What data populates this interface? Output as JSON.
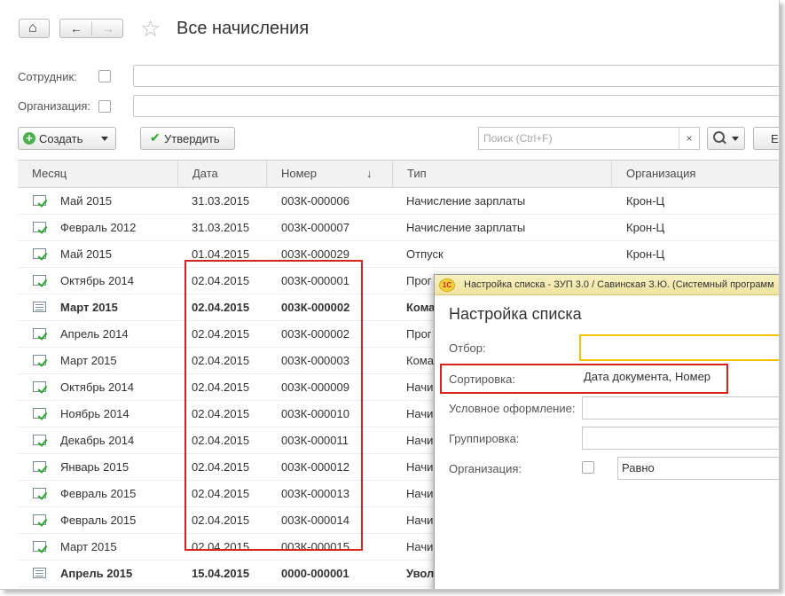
{
  "header": {
    "title": "Все начисления",
    "home_icon": "⌂",
    "back_icon": "←",
    "forward_icon": "→",
    "favorite_icon": "☆"
  },
  "filters": {
    "employee_label": "Сотрудник:",
    "employee_value": "",
    "organization_label": "Организация:",
    "organization_value": ""
  },
  "toolbar": {
    "create_label": "Создать",
    "approve_label": "Утвердить",
    "search_placeholder": "Поиск (Ctrl+F)",
    "clear_icon": "×",
    "search_icon": "🔍",
    "more_label": "Е"
  },
  "table": {
    "columns": [
      "Месяц",
      "Дата",
      "Номер",
      "Тип",
      "Организация"
    ],
    "sort_indicator": "↓",
    "rows": [
      {
        "month": "Май 2015",
        "date": "31.03.2015",
        "number": "003К-000006",
        "type": "Начисление зарплаты",
        "org": "Крон-Ц",
        "status": "posted",
        "bold": false
      },
      {
        "month": "Февраль 2012",
        "date": "31.03.2015",
        "number": "003К-000007",
        "type": "Начисление зарплаты",
        "org": "Крон-Ц",
        "status": "posted",
        "bold": false
      },
      {
        "month": "Май 2015",
        "date": "01.04.2015",
        "number": "003К-000029",
        "type": "Отпуск",
        "org": "Крон-Ц",
        "status": "posted",
        "bold": false
      },
      {
        "month": "Октябрь 2014",
        "date": "02.04.2015",
        "number": "003К-000001",
        "type": "Прог",
        "org": "",
        "status": "posted",
        "bold": false
      },
      {
        "month": "Март 2015",
        "date": "02.04.2015",
        "number": "003К-000002",
        "type": "Кома",
        "org": "",
        "status": "draft",
        "bold": true
      },
      {
        "month": "Апрель 2014",
        "date": "02.04.2015",
        "number": "003К-000002",
        "type": "Прог",
        "org": "",
        "status": "posted",
        "bold": false
      },
      {
        "month": "Март 2015",
        "date": "02.04.2015",
        "number": "003К-000003",
        "type": "Кома",
        "org": "",
        "status": "posted",
        "bold": false
      },
      {
        "month": "Октябрь 2014",
        "date": "02.04.2015",
        "number": "003К-000009",
        "type": "Начи",
        "org": "",
        "status": "posted",
        "bold": false
      },
      {
        "month": "Ноябрь 2014",
        "date": "02.04.2015",
        "number": "003К-000010",
        "type": "Начи",
        "org": "",
        "status": "posted",
        "bold": false
      },
      {
        "month": "Декабрь 2014",
        "date": "02.04.2015",
        "number": "003К-000011",
        "type": "Начи",
        "org": "",
        "status": "posted",
        "bold": false
      },
      {
        "month": "Январь 2015",
        "date": "02.04.2015",
        "number": "003К-000012",
        "type": "Начи",
        "org": "",
        "status": "posted",
        "bold": false
      },
      {
        "month": "Февраль 2015",
        "date": "02.04.2015",
        "number": "003К-000013",
        "type": "Начи",
        "org": "",
        "status": "posted",
        "bold": false
      },
      {
        "month": "Февраль 2015",
        "date": "02.04.2015",
        "number": "003К-000014",
        "type": "Начи",
        "org": "",
        "status": "posted",
        "bold": false
      },
      {
        "month": "Март 2015",
        "date": "02.04.2015",
        "number": "003К-000015",
        "type": "Начи",
        "org": "",
        "status": "posted",
        "bold": false
      },
      {
        "month": "Апрель 2015",
        "date": "15.04.2015",
        "number": "0000-000001",
        "type": "Увол",
        "org": "",
        "status": "draft",
        "bold": true
      }
    ]
  },
  "dialog": {
    "window_title": "Настройка списка - ЗУП 3.0 / Савинская З.Ю. (Системный программ",
    "logo_text": "1С",
    "heading": "Настройка списка",
    "filter_label": "Отбор:",
    "filter_value": "",
    "sort_label": "Сортировка:",
    "sort_value": "Дата документа, Номер",
    "conditional_label": "Условное оформление:",
    "conditional_value": "",
    "grouping_label": "Группировка:",
    "grouping_value": "",
    "organization_label": "Организация:",
    "organization_condition": "Равно"
  },
  "colors": {
    "highlight": "#d9231f",
    "accent_yellow": "#f2c400",
    "posted_check": "#2aa52a"
  }
}
